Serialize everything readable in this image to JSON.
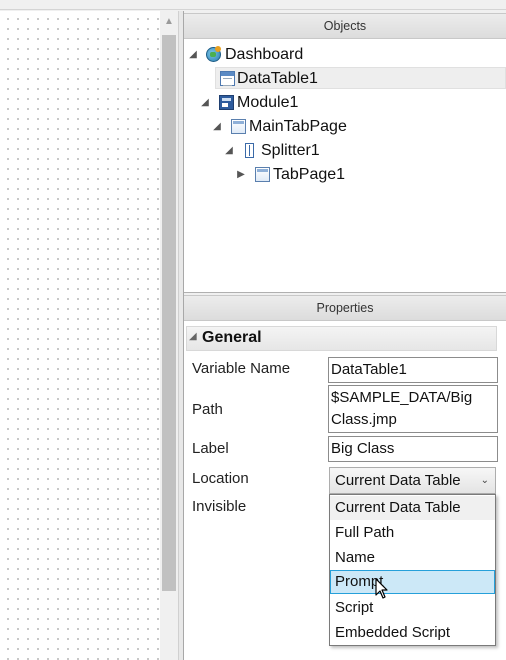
{
  "objects_panel": {
    "title": "Objects",
    "tree": [
      {
        "label": "Dashboard",
        "icon": "dashboard-icon",
        "expanded": true
      },
      {
        "label": "DataTable1",
        "icon": "datatable-icon",
        "selected": true
      },
      {
        "label": "Module1",
        "icon": "module-icon",
        "expanded": true
      },
      {
        "label": "MainTabPage",
        "icon": "tabpage-icon",
        "expanded": true
      },
      {
        "label": "Splitter1",
        "icon": "splitter-icon",
        "expanded": true
      },
      {
        "label": "TabPage1",
        "icon": "tabpage-icon",
        "expanded": false
      }
    ]
  },
  "properties_panel": {
    "title": "Properties",
    "section": "General",
    "fields": {
      "variable_name": {
        "label": "Variable Name",
        "value": "DataTable1"
      },
      "path": {
        "label": "Path",
        "value_line1": "$SAMPLE_DATA/Big",
        "value_line2": "Class.jmp"
      },
      "label": {
        "label": "Label",
        "value": "Big Class"
      },
      "location": {
        "label": "Location",
        "value": "Current Data Table"
      },
      "invisible": {
        "label": "Invisible"
      }
    },
    "location_dropdown": {
      "options": [
        "Current Data Table",
        "Full Path",
        "Name",
        "Prompt",
        "Script",
        "Embedded Script"
      ],
      "hovered": "Prompt"
    }
  },
  "colors": {
    "selection_hover": "#cce8f7",
    "selection_border": "#26a0da",
    "panel_header": "#e4e4e4"
  }
}
